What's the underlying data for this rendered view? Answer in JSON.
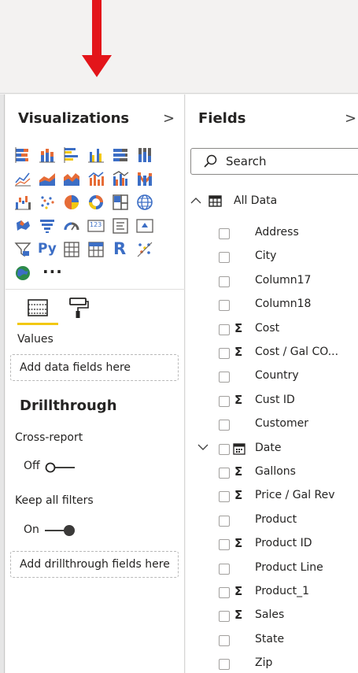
{
  "viz_pane": {
    "title": "Visualizations",
    "chevron": ">",
    "more_label": "···",
    "tabs": [
      "fields-well-icon",
      "format-paint-roller-icon"
    ],
    "values_label": "Values",
    "values_placeholder": "Add data fields here",
    "drillthrough_heading": "Drillthrough",
    "cross_report_label": "Cross-report",
    "cross_report_state": "Off",
    "keep_filters_label": "Keep all filters",
    "keep_filters_state": "On",
    "drillthrough_placeholder": "Add drillthrough fields here",
    "visual_icons": [
      "stacked-bar-chart-icon",
      "stacked-column-chart-icon",
      "clustered-bar-chart-icon",
      "clustered-column-chart-icon",
      "100-stacked-bar-chart-icon",
      "100-stacked-column-chart-icon",
      "line-chart-icon",
      "area-chart-icon",
      "stacked-area-chart-icon",
      "line-and-stacked-column-chart-icon",
      "line-and-clustered-column-chart-icon",
      "ribbon-chart-icon",
      "waterfall-chart-icon",
      "scatter-chart-icon",
      "pie-chart-icon",
      "donut-chart-icon",
      "treemap-icon",
      "map-icon",
      "filled-map-icon",
      "funnel-icon",
      "gauge-icon",
      "card-icon",
      "multi-row-card-icon",
      "kpi-icon",
      "slicer-icon",
      "python-visual-icon",
      "table-icon",
      "matrix-icon",
      "r-script-visual-icon",
      "key-influencers-icon",
      "arcgis-map-icon"
    ],
    "python_label": "Py",
    "r_label": "R",
    "card_label": "123"
  },
  "fields_pane": {
    "title": "Fields",
    "chevron": ">",
    "search_placeholder": "Search",
    "table_name": "All Data",
    "fields": [
      {
        "label": "Address",
        "sigma": false
      },
      {
        "label": "City",
        "sigma": false
      },
      {
        "label": "Column17",
        "sigma": false
      },
      {
        "label": "Column18",
        "sigma": false
      },
      {
        "label": "Cost",
        "sigma": true
      },
      {
        "label": "Cost / Gal CO...",
        "sigma": true
      },
      {
        "label": "Country",
        "sigma": false
      },
      {
        "label": "Cust ID",
        "sigma": true
      },
      {
        "label": "Customer",
        "sigma": false
      },
      {
        "label": "Date",
        "sigma": false,
        "date_hierarchy": true
      },
      {
        "label": "Gallons",
        "sigma": true
      },
      {
        "label": "Price / Gal Rev",
        "sigma": true
      },
      {
        "label": "Product",
        "sigma": false
      },
      {
        "label": "Product ID",
        "sigma": true
      },
      {
        "label": "Product Line",
        "sigma": false
      },
      {
        "label": "Product_1",
        "sigma": true
      },
      {
        "label": "Sales",
        "sigma": true
      },
      {
        "label": "State",
        "sigma": false
      },
      {
        "label": "Zip",
        "sigma": false
      }
    ],
    "sigma_symbol": "Σ"
  },
  "colors": {
    "accent_yellow": "#f2c811",
    "arrow_red": "#e3151a",
    "chart_blue": "#3c6ec5",
    "chart_orange": "#e66c37",
    "chart_yellow": "#f2c811"
  }
}
